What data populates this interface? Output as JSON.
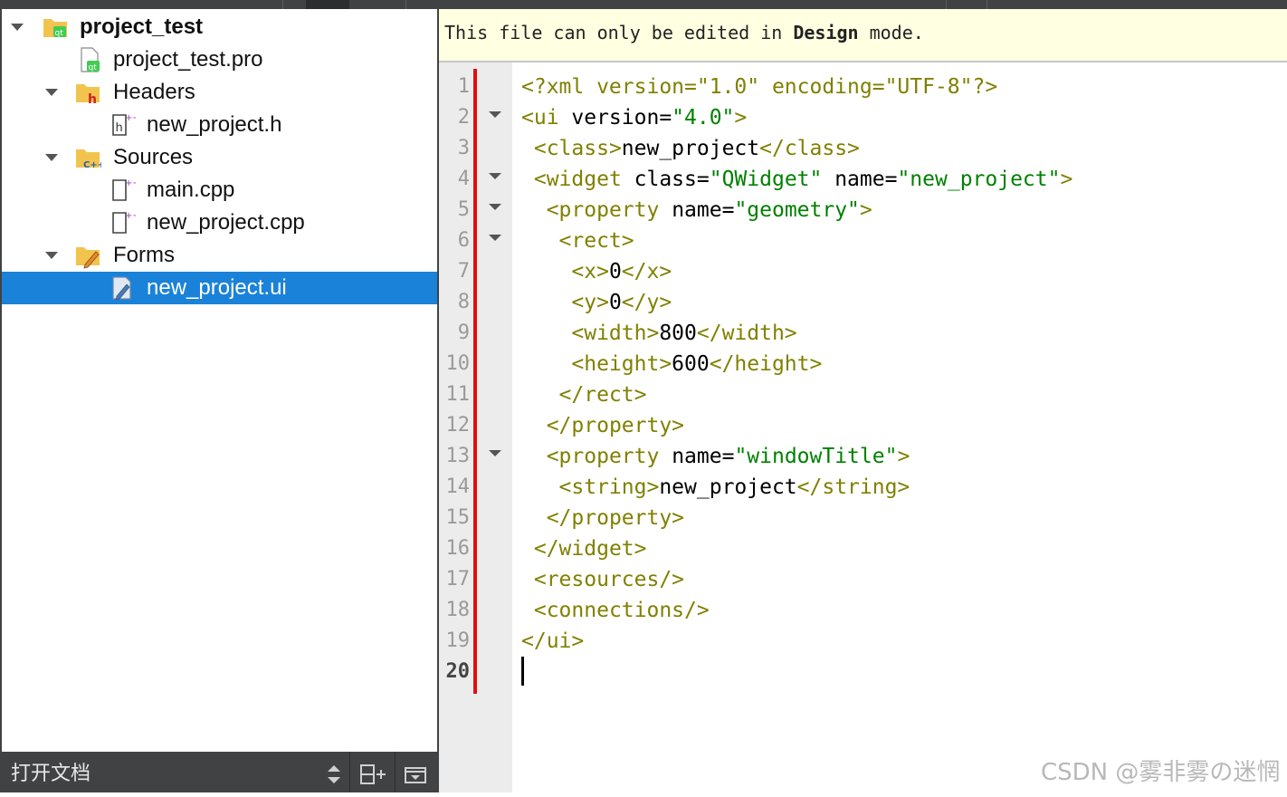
{
  "project_tree": {
    "project_name": "project_test",
    "project_file": "project_test.pro",
    "headers_label": "Headers",
    "header_file": "new_project.h",
    "sources_label": "Sources",
    "source_main": "main.cpp",
    "source_project": "new_project.cpp",
    "forms_label": "Forms",
    "form_file": "new_project.ui"
  },
  "bottom_bar": {
    "open_documents_label": "打开文档"
  },
  "editor": {
    "info_prefix": "This file can only be edited in ",
    "info_mode": "Design",
    "info_suffix": " mode.",
    "line_numbers": [
      "1",
      "2",
      "3",
      "4",
      "5",
      "6",
      "7",
      "8",
      "9",
      "10",
      "11",
      "12",
      "13",
      "14",
      "15",
      "16",
      "17",
      "18",
      "19",
      "20"
    ],
    "current_line": "20",
    "code": {
      "l1_a": "<?xml version=\"1.0\" encoding=\"UTF-8\"?>",
      "l2_open": "<ui ",
      "l2_attr": "version=",
      "l2_val": "\"4.0\"",
      "l2_close": ">",
      "l3_open": "<class>",
      "l3_text": "new_project",
      "l3_close": "</class>",
      "l4_open": "<widget ",
      "l4_attr1": "class=",
      "l4_val1": "\"QWidget\"",
      "l4_attr2": " name=",
      "l4_val2": "\"new_project\"",
      "l4_close": ">",
      "l5_open": "<property ",
      "l5_attr": "name=",
      "l5_val": "\"geometry\"",
      "l5_close": ">",
      "l6": "<rect>",
      "l7_open": "<x>",
      "l7_text": "0",
      "l7_close": "</x>",
      "l8_open": "<y>",
      "l8_text": "0",
      "l8_close": "</y>",
      "l9_open": "<width>",
      "l9_text": "800",
      "l9_close": "</width>",
      "l10_open": "<height>",
      "l10_text": "600",
      "l10_close": "</height>",
      "l11": "</rect>",
      "l12": "</property>",
      "l13_open": "<property ",
      "l13_attr": "name=",
      "l13_val": "\"windowTitle\"",
      "l13_close": ">",
      "l14_open": "<string>",
      "l14_text": "new_project",
      "l14_close": "</string>",
      "l15": "</property>",
      "l16": "</widget>",
      "l17": "<resources/>",
      "l18": "<connections/>",
      "l19": "</ui>"
    }
  },
  "watermark": "CSDN @雾非雾の迷惘",
  "colors": {
    "tag": "#808000",
    "string": "#008000",
    "selection": "#1a82d9",
    "info_bar": "#ffffe1",
    "change_bar": "#e01010"
  }
}
